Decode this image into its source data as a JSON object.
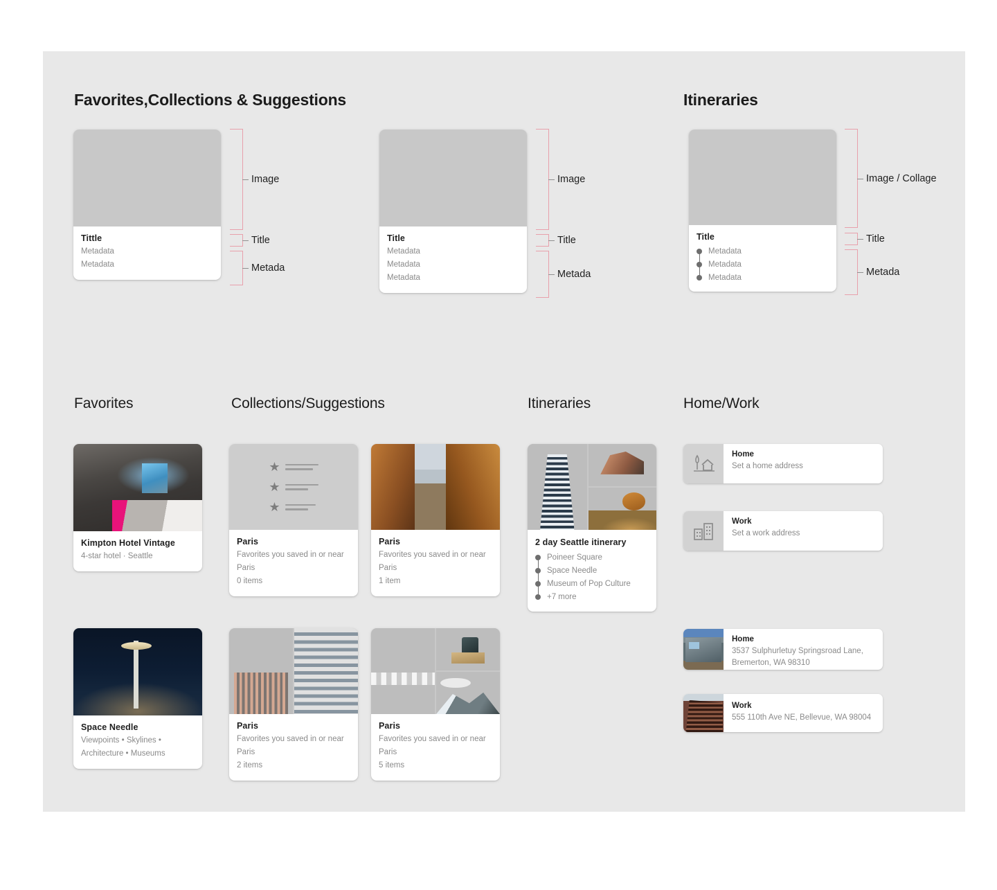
{
  "page": {
    "background": "#e8e8e8",
    "accent_bracket_color": "#e8a0ab"
  },
  "spec_section": {
    "heading_left": "Favorites,Collections & Suggestions",
    "heading_right": "Itineraries",
    "cards": [
      {
        "name": "favorites-spec-card",
        "title": "Tittle",
        "metadata": [
          "Metadata",
          "Metadata"
        ],
        "brackets": [
          {
            "label": "Image"
          },
          {
            "label": "Title"
          },
          {
            "label": "Metada"
          }
        ]
      },
      {
        "name": "collections-spec-card",
        "title": "Title",
        "metadata": [
          "Metadata",
          "Metadata",
          "Metadata"
        ],
        "brackets": [
          {
            "label": "Image"
          },
          {
            "label": "Title"
          },
          {
            "label": "Metada"
          }
        ]
      },
      {
        "name": "itinerary-spec-card",
        "title": "Title",
        "metadata": [
          "Metadata",
          "Metadata",
          "Metadata"
        ],
        "brackets": [
          {
            "label": "Image / Collage"
          },
          {
            "label": "Title"
          },
          {
            "label": "Metada"
          }
        ]
      }
    ]
  },
  "examples_section": {
    "columns": [
      {
        "name": "favorites",
        "heading": "Favorites"
      },
      {
        "name": "collections-suggestions",
        "heading": "Collections/Suggestions"
      },
      {
        "name": "itineraries",
        "heading": "Itineraries"
      },
      {
        "name": "home-work",
        "heading": "Home/Work"
      }
    ]
  },
  "favorites": [
    {
      "title": "Kimpton Hotel Vintage",
      "subtitle": "4-star hotel · Seattle",
      "image": "hotel-room-photo"
    },
    {
      "title": "Space Needle",
      "subtitle": "Viewpoints • Skylines • Architecture • Museums",
      "image": "space-needle-night-photo"
    }
  ],
  "collections": [
    {
      "title": "Paris",
      "subtitle": "Favorites you saved in or near Paris",
      "count": "0 items",
      "image": "saved-list-placeholder"
    },
    {
      "title": "Paris",
      "subtitle": "Favorites you saved in or near Paris",
      "count": "1 item",
      "image": "street-scene-photo"
    },
    {
      "title": "Paris",
      "subtitle": "Favorites you saved in or near Paris",
      "count": "2 items",
      "image": "city-and-highrise-collage"
    },
    {
      "title": "Paris",
      "subtitle": "Favorites you saved in or near Paris",
      "count": "5 items",
      "image": "camera-mountain-beach-collage"
    }
  ],
  "itineraries": [
    {
      "title": "2 day Seattle itinerary",
      "stops": [
        "Poineer Square",
        "Space Needle",
        "Museum of Pop Culture",
        "+7 more"
      ],
      "image": "halfdome-stones-tower-collage"
    }
  ],
  "home_work": {
    "empty_states": [
      {
        "title": "Home",
        "subtitle": "Set a home address",
        "icon": "home-tree-icon"
      },
      {
        "title": "Work",
        "subtitle": "Set a work address",
        "icon": "office-buildings-icon"
      }
    ],
    "filled_states": [
      {
        "title": "Home",
        "subtitle": "3537 Sulphurletuy Springsroad Lane, Bremerton, WA 98310",
        "image": "house-photo"
      },
      {
        "title": "Work",
        "subtitle": "555 110th Ave NE, Bellevue, WA 98004",
        "image": "office-tower-photo"
      }
    ]
  }
}
